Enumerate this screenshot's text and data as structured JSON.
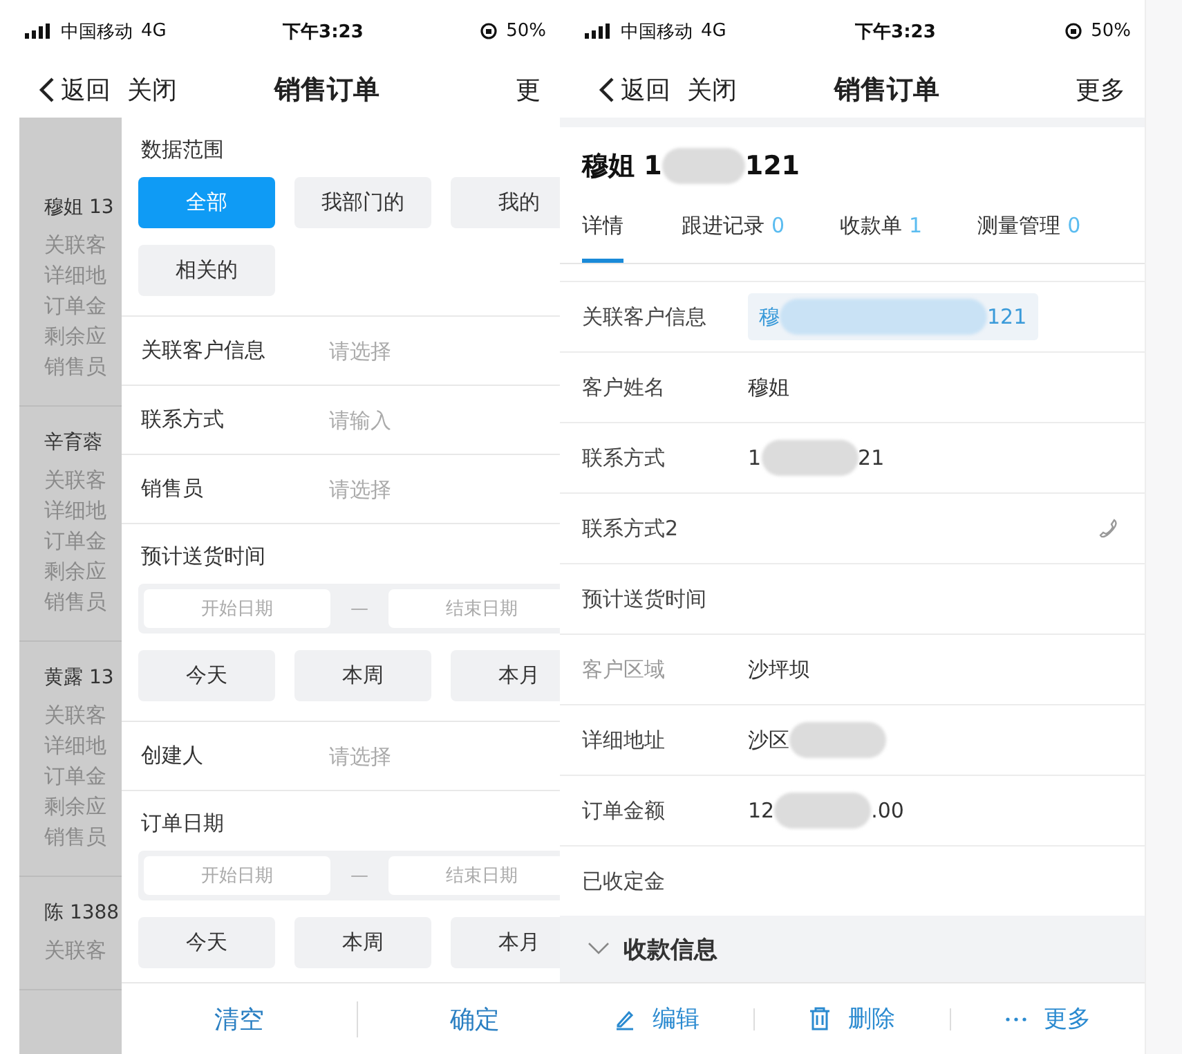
{
  "left_screen": {
    "status_bar": {
      "carrier": "中国移动",
      "network": "4G",
      "time": "下午3:23",
      "battery": "50%"
    },
    "nav": {
      "back": "返回",
      "close": "关闭",
      "title": "销售订单",
      "more": "更"
    },
    "list_cards": [
      {
        "title": "穆姐 13",
        "lines": [
          "关联客",
          "详细地",
          "订单金",
          "剩余应",
          "销售员"
        ]
      },
      {
        "title": "辛育蓉",
        "lines": [
          "关联客",
          "详细地",
          "订单金",
          "剩余应",
          "销售员"
        ]
      },
      {
        "title": "黄露 13",
        "lines": [
          "关联客",
          "详细地",
          "订单金",
          "剩余应",
          "销售员"
        ]
      },
      {
        "title": "陈 1388",
        "lines": [
          "关联客"
        ]
      }
    ],
    "filter_drawer": {
      "sections": [
        {
          "kind": "chips",
          "label": "数据范围",
          "chips": [
            {
              "label": "全部",
              "selected": true
            },
            {
              "label": "我部门的",
              "selected": false
            },
            {
              "label": "我的",
              "selected": false
            },
            {
              "label": "相关的",
              "selected": false
            }
          ]
        },
        {
          "kind": "field",
          "label": "关联客户信息",
          "placeholder": "请选择"
        },
        {
          "kind": "field",
          "label": "联系方式",
          "placeholder": "请输入"
        },
        {
          "kind": "field",
          "label": "销售员",
          "placeholder": "请选择"
        },
        {
          "kind": "dates",
          "label": "预计送货时间",
          "start_placeholder": "开始日期",
          "separator": "—",
          "end_placeholder": "结束日期",
          "quick": [
            "今天",
            "本周",
            "本月"
          ]
        },
        {
          "kind": "field",
          "label": "创建人",
          "placeholder": "请选择"
        },
        {
          "kind": "dates",
          "label": "订单日期",
          "start_placeholder": "开始日期",
          "separator": "—",
          "end_placeholder": "结束日期",
          "quick": [
            "今天",
            "本周",
            "本月"
          ]
        }
      ],
      "footer": [
        "清空",
        "确定"
      ]
    }
  },
  "right_screen": {
    "status_bar": {
      "carrier": "中国移动",
      "network": "4G",
      "time": "下午3:23",
      "battery": "50%"
    },
    "nav": {
      "back": "返回",
      "close": "关闭",
      "title": "销售订单",
      "more": "更多"
    },
    "record_title": [
      "穆姐 1",
      "121"
    ],
    "tabs": [
      {
        "label": "详情",
        "selected": true
      },
      {
        "label": "跟进记录",
        "count": "0",
        "selected": false
      },
      {
        "label": "收款单",
        "count": "1",
        "selected": false
      },
      {
        "label": "测量管理",
        "count": "0",
        "selected": false
      }
    ],
    "fields": [
      {
        "kind": "tag",
        "label": "关联客户信息",
        "value": [
          "穆",
          "121"
        ],
        "redacted": true,
        "muted": false
      },
      {
        "kind": "text",
        "label": "客户姓名",
        "value": [
          "穆姐"
        ],
        "redacted": false,
        "muted": false
      },
      {
        "kind": "text",
        "label": "联系方式",
        "value": [
          "1",
          "21"
        ],
        "redacted": true,
        "muted": false
      },
      {
        "kind": "phone",
        "label": "联系方式2",
        "muted": false
      },
      {
        "kind": "text",
        "label": "预计送货时间",
        "muted": false
      },
      {
        "kind": "text",
        "label": "客户区域",
        "value": [
          "沙坪坝"
        ],
        "redacted": false,
        "muted": true
      },
      {
        "kind": "text",
        "label": "详细地址",
        "value": [
          "沙区"
        ],
        "redacted": true,
        "muted": false
      },
      {
        "kind": "text",
        "label": "订单金额",
        "value": [
          "12",
          ".00"
        ],
        "redacted": true,
        "muted": false
      },
      {
        "kind": "text",
        "label": "已收定金",
        "muted": false
      }
    ],
    "section": {
      "title": "收款信息",
      "expanded": false
    },
    "actions": [
      {
        "kind": "edit",
        "label": "编辑"
      },
      {
        "kind": "delete",
        "label": "删除"
      },
      {
        "kind": "more",
        "label": "更多"
      }
    ]
  }
}
